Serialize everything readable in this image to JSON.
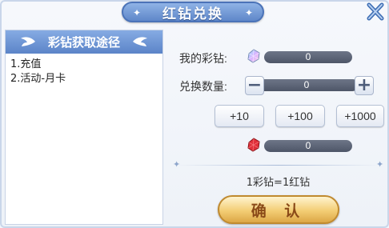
{
  "window": {
    "title": "红钻兑换"
  },
  "left_panel": {
    "header": "彩钻获取途径",
    "methods": [
      "1.充值",
      "2.活动-月卡"
    ]
  },
  "my_gems": {
    "label": "我的彩钻:",
    "value": "0",
    "icon": "rainbow-gem-icon"
  },
  "exchange": {
    "label": "兑换数量:",
    "value": "0",
    "minus": "−",
    "plus": "+"
  },
  "quick_add": [
    "+10",
    "+100",
    "+1000"
  ],
  "red_gems": {
    "value": "0",
    "icon": "red-gem-icon"
  },
  "rate_text": "1彩钻=1红钻",
  "confirm_label": "确 认",
  "colors": {
    "accent": "#5f87c9",
    "button_gold": "#f3cd74",
    "bar": "#5c6476"
  }
}
